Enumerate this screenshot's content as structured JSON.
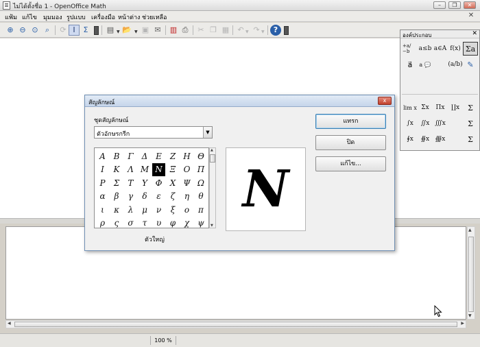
{
  "window": {
    "title": "ไม่ได้ตั้งชื่อ 1 - OpenOffice Math",
    "controls": {
      "minimize": "–",
      "restore": "❐",
      "close": "✕"
    }
  },
  "menubar": {
    "items": [
      "แฟ้ม",
      "แก้ไข",
      "มุมมอง",
      "รูปแบบ",
      "เครื่องมือ",
      "หน้าต่าง",
      "ช่วยเหลือ"
    ],
    "doc_close": "✕"
  },
  "toolbar": {
    "buttons": [
      {
        "icon": "zoom-in-icon",
        "glyph": "⊕"
      },
      {
        "icon": "zoom-out-icon",
        "glyph": "⊖"
      },
      {
        "icon": "zoom-100-icon",
        "glyph": "⊙"
      },
      {
        "icon": "show-all-icon",
        "glyph": "⌕"
      },
      {
        "icon": "update-icon",
        "glyph": "⟳"
      },
      {
        "icon": "formula-cursor-icon",
        "glyph": "I"
      },
      {
        "icon": "symbols-icon",
        "glyph": "Σ"
      },
      {
        "icon": "new-icon",
        "glyph": "▤"
      },
      {
        "icon": "open-icon",
        "glyph": "📂"
      },
      {
        "icon": "save-icon",
        "glyph": "▣"
      },
      {
        "icon": "send-mail-icon",
        "glyph": "✉"
      },
      {
        "icon": "export-pdf-icon",
        "glyph": "▥"
      },
      {
        "icon": "print-icon",
        "glyph": "⎙"
      },
      {
        "icon": "cut-icon",
        "glyph": "✂"
      },
      {
        "icon": "copy-icon",
        "glyph": "❐"
      },
      {
        "icon": "paste-icon",
        "glyph": "▦"
      },
      {
        "icon": "undo-icon",
        "glyph": "↶"
      },
      {
        "icon": "redo-icon",
        "glyph": "↷"
      },
      {
        "icon": "help-icon",
        "glyph": "?"
      }
    ]
  },
  "elements_panel": {
    "title": "องค์ประกอบ",
    "close": "✕",
    "top_row1": [
      "+a/−b",
      "a≤b",
      "a∈A",
      "f(x)",
      "Σa"
    ],
    "top_row2": [
      "a⃗",
      "a 💬",
      "",
      "(a/b)",
      "✎"
    ],
    "bottom_row1": [
      "lim x",
      "Σx",
      "Πx",
      "∐x",
      "Σ"
    ],
    "bottom_row2": [
      "∫x",
      "∬x",
      "∭x",
      "",
      "Σ"
    ],
    "bottom_row3": [
      "∮x",
      "∯x",
      "∰x",
      "",
      "Σ"
    ]
  },
  "symbols_dialog": {
    "title": "สัญลักษณ์",
    "close": "x",
    "set_label": "ชุดสัญลักษณ์",
    "set_value": "ตัวอักษรกรีก",
    "symbol_name": "ตัวใหญ่",
    "preview_symbol": "N",
    "buttons": {
      "insert": "แทรก",
      "close": "ปิด",
      "edit": "แก้ไข..."
    },
    "symbols": [
      [
        "Α",
        "Β",
        "Γ",
        "Δ",
        "Ε",
        "Ζ",
        "Η",
        "Θ"
      ],
      [
        "Ι",
        "Κ",
        "Λ",
        "Μ",
        "Ν",
        "Ξ",
        "Ο",
        "Π"
      ],
      [
        "Ρ",
        "Σ",
        "Τ",
        "Υ",
        "Φ",
        "Χ",
        "Ψ",
        "Ω"
      ],
      [
        "α",
        "β",
        "γ",
        "δ",
        "ε",
        "ζ",
        "η",
        "θ"
      ],
      [
        "ι",
        "κ",
        "λ",
        "μ",
        "ν",
        "ξ",
        "ο",
        "π"
      ],
      [
        "ρ",
        "ς",
        "σ",
        "τ",
        "υ",
        "φ",
        "χ",
        "ψ"
      ]
    ],
    "selected_symbol": "Ν"
  },
  "statusbar": {
    "zoom": "100 %"
  }
}
